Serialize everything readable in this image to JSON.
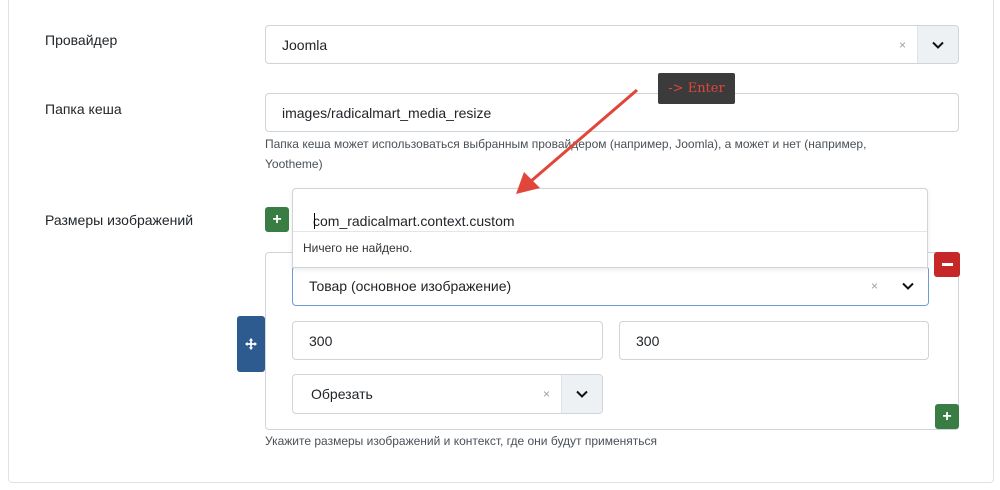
{
  "provider": {
    "label": "Провайдер",
    "value": "Joomla",
    "clear": "×"
  },
  "cache_folder": {
    "label": "Папка кеша",
    "value": "images/radicalmart_media_resize",
    "help_line1": "Папка кеша может использоваться выбранным провайдером (например, Joomla), а может и нет (например,",
    "help_line2": "Yootheme)"
  },
  "image_sizes": {
    "label": "Размеры изображений",
    "search_value": "com_radicalmart.context.custom",
    "no_results": "Ничего не найдено.",
    "context_value": "Товар (основное изображение)",
    "width_value": "300",
    "height_value": "300",
    "mode_value": "Обрезать",
    "help": "Укажите размеры изображений и контекст, где они будут применяться",
    "clear": "×"
  },
  "annotation": {
    "enter_label": "-> Enter",
    "arrow_color": "#e0463a"
  },
  "colors": {
    "add": "#3a7d44",
    "remove": "#c52827",
    "move": "#2e5b8f"
  },
  "icons": {
    "add": "plus-icon",
    "remove": "minus-icon",
    "move": "move-icon",
    "dropdown": "chevron-down-icon"
  }
}
